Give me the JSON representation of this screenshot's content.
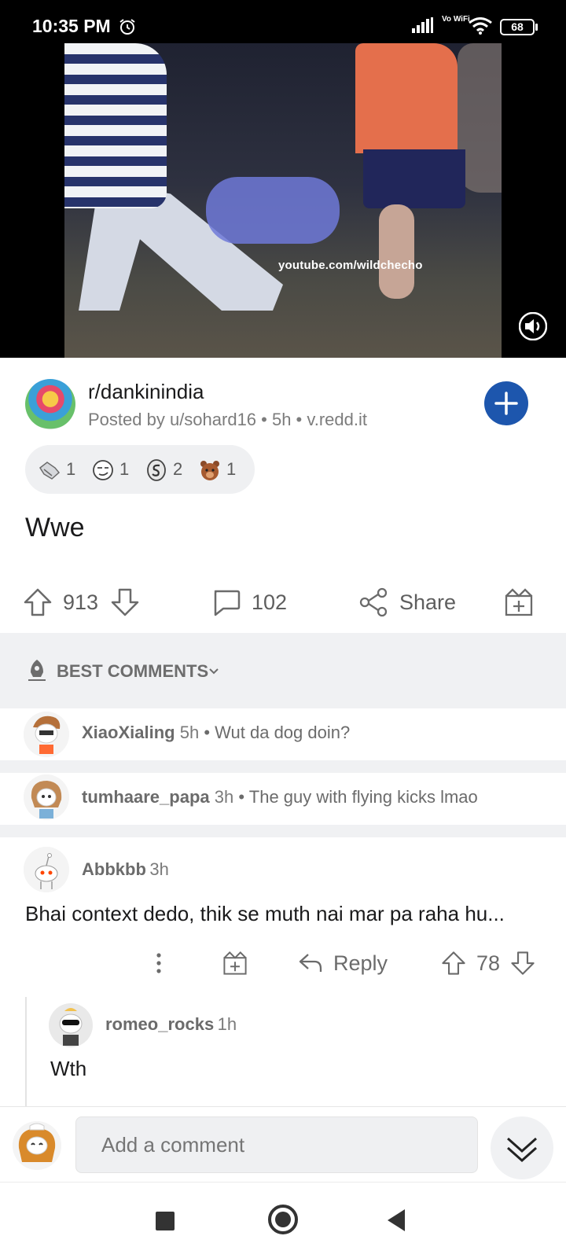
{
  "status_bar": {
    "time": "10:35 PM",
    "vowifi": "Vo WiFi",
    "battery": "68"
  },
  "video": {
    "watermark": "youtube.com/wildchecho",
    "volume_icon": "volume-on-icon"
  },
  "post": {
    "subreddit": "r/dankinindia",
    "meta": "Posted by u/sohard16 • 5h • v.redd.it",
    "join_icon": "plus-icon",
    "awards": [
      {
        "icon": "award-handshake-icon",
        "count": "1"
      },
      {
        "icon": "award-smirk-icon",
        "count": "1"
      },
      {
        "icon": "award-coin-icon",
        "count": "2"
      },
      {
        "icon": "award-bear-icon",
        "count": "1"
      }
    ],
    "title": "Wwe",
    "upvotes": "913",
    "comments": "102",
    "share_label": "Share"
  },
  "sort": {
    "label": "BEST COMMENTS"
  },
  "collapsed_comments": [
    {
      "author": "XiaoXialing",
      "time": "5h",
      "preview": "Wut da dog doin?"
    },
    {
      "author": "tumhaare_papa",
      "time": "3h",
      "preview": "The guy with flying kicks lmao"
    }
  ],
  "comment": {
    "author": "Abbkbb",
    "time": "3h",
    "body": "Bhai context dedo, thik se muth nai mar pa raha hu...",
    "reply_label": "Reply",
    "score": "78"
  },
  "reply": {
    "author": "romeo_rocks",
    "time": "1h",
    "body": "Wth"
  },
  "input": {
    "placeholder": "Add a comment"
  },
  "colors": {
    "accent": "#1d56ad",
    "muted": "#7c7c7c",
    "panel": "#f0f1f3"
  }
}
